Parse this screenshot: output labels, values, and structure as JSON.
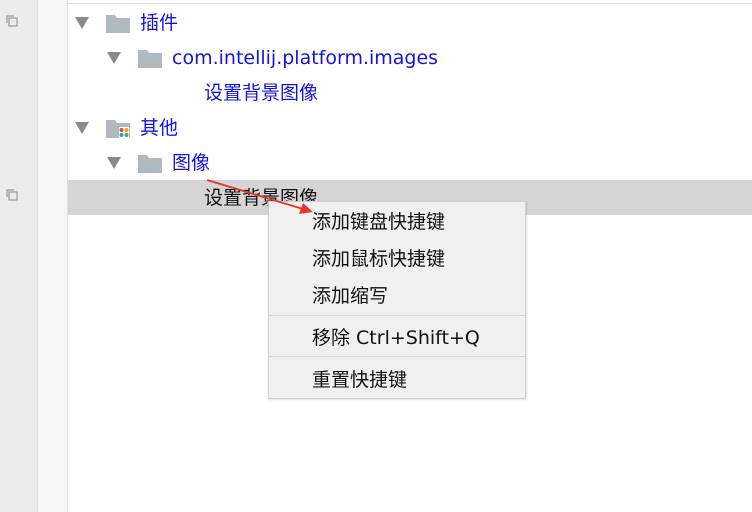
{
  "tree": {
    "rows": [
      {
        "label": "插件",
        "expanded": true,
        "icon": "folder-icon"
      },
      {
        "label": "com.intellij.platform.images",
        "expanded": true,
        "icon": "folder-icon"
      },
      {
        "label": "设置背景图像",
        "icon": null
      },
      {
        "label": "其他",
        "expanded": true,
        "icon": "folder-other-icon"
      },
      {
        "label": "图像",
        "expanded": true,
        "icon": "folder-icon"
      },
      {
        "label": "设置背景图像",
        "selected": true,
        "icon": null
      }
    ]
  },
  "context_menu": {
    "items": [
      {
        "label": "添加键盘快捷键"
      },
      {
        "label": "添加鼠标快捷键"
      },
      {
        "label": "添加缩写"
      },
      {
        "label": "移除 Ctrl+Shift+Q"
      },
      {
        "label": "重置快捷键"
      }
    ]
  },
  "colors": {
    "tree_text": "#1414e0",
    "selection": "#d5d5d5",
    "menu_bg": "#f0f0f0",
    "folder": "#aeb9c0",
    "annotation_arrow": "#e8342c"
  }
}
